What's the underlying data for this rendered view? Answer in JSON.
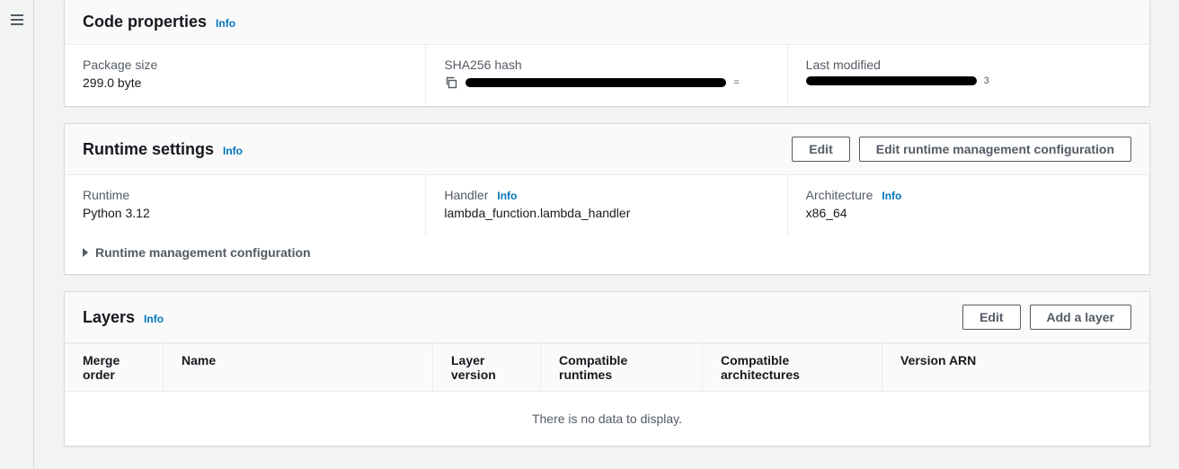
{
  "codeProperties": {
    "title": "Code properties",
    "info": "Info",
    "packageSize": {
      "label": "Package size",
      "value": "299.0 byte"
    },
    "sha256": {
      "label": "SHA256 hash",
      "valueRedacted": true,
      "tail": "="
    },
    "lastModified": {
      "label": "Last modified",
      "valueRedacted": true,
      "tail": "3"
    }
  },
  "runtimeSettings": {
    "title": "Runtime settings",
    "info": "Info",
    "editBtn": "Edit",
    "editRmcBtn": "Edit runtime management configuration",
    "runtime": {
      "label": "Runtime",
      "value": "Python 3.12"
    },
    "handler": {
      "label": "Handler",
      "info": "Info",
      "value": "lambda_function.lambda_handler"
    },
    "architecture": {
      "label": "Architecture",
      "info": "Info",
      "value": "x86_64"
    },
    "rmcExpand": "Runtime management configuration"
  },
  "layers": {
    "title": "Layers",
    "info": "Info",
    "editBtn": "Edit",
    "addBtn": "Add a layer",
    "columns": {
      "mergeOrder": "Merge order",
      "name": "Name",
      "layerVersion": "Layer version",
      "compatibleRuntimes": "Compatible runtimes",
      "compatibleArchitectures": "Compatible architectures",
      "versionArn": "Version ARN"
    },
    "empty": "There is no data to display."
  }
}
